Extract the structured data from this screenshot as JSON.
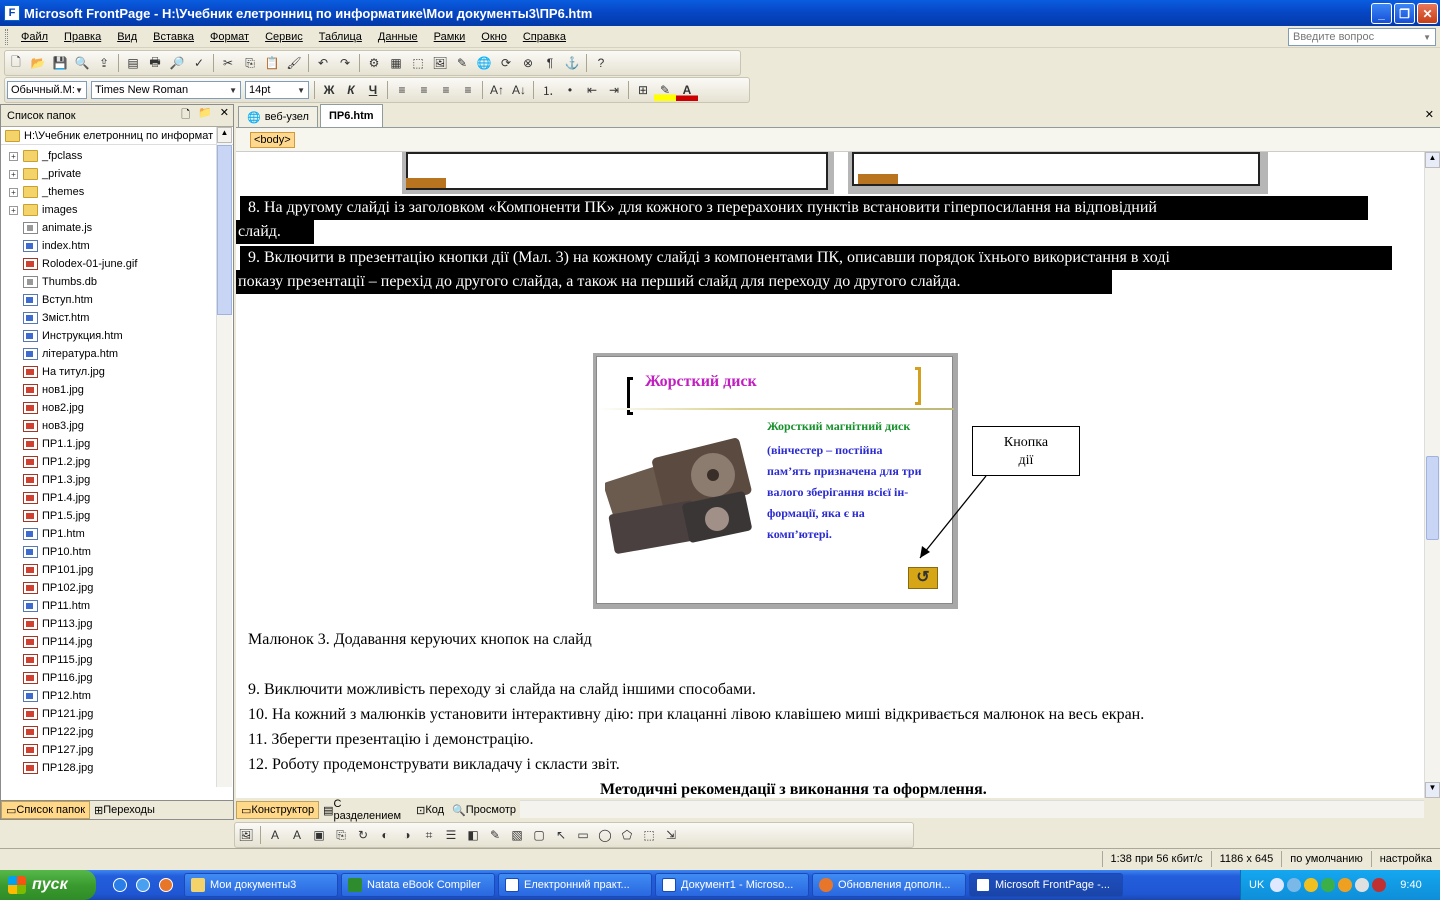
{
  "title": "Microsoft FrontPage - H:\\Учебник елетронниц по информатике\\Мои документы3\\ПР6.htm",
  "menu": [
    "Файл",
    "Правка",
    "Вид",
    "Вставка",
    "Формат",
    "Сервис",
    "Таблица",
    "Данные",
    "Рамки",
    "Окно",
    "Справка"
  ],
  "help_placeholder": "Введите вопрос",
  "format": {
    "style": "Обычный.М:",
    "font": "Times New Roman",
    "size": "14pt",
    "bold": "Ж",
    "italic": "К",
    "underline": "Ч"
  },
  "folder_panel": {
    "title": "Список папок",
    "root": "H:\\Учебник елетронниц по информат",
    "items": [
      {
        "name": "_fpclass",
        "type": "folder",
        "exp": "+"
      },
      {
        "name": "_private",
        "type": "folder",
        "exp": "+"
      },
      {
        "name": "_themes",
        "type": "folder",
        "exp": "+"
      },
      {
        "name": "images",
        "type": "folder",
        "exp": "+"
      },
      {
        "name": "animate.js",
        "type": "js"
      },
      {
        "name": "index.htm",
        "type": "htm"
      },
      {
        "name": "Rolodex-01-june.gif",
        "type": "jpg"
      },
      {
        "name": "Thumbs.db",
        "type": "js"
      },
      {
        "name": "Вступ.htm",
        "type": "htm"
      },
      {
        "name": "Зміст.htm",
        "type": "htm"
      },
      {
        "name": "Инструкция.htm",
        "type": "htm"
      },
      {
        "name": "література.htm",
        "type": "htm"
      },
      {
        "name": "На титул.jpg",
        "type": "jpg"
      },
      {
        "name": "нов1.jpg",
        "type": "jpg"
      },
      {
        "name": "нов2.jpg",
        "type": "jpg"
      },
      {
        "name": "нов3.jpg",
        "type": "jpg"
      },
      {
        "name": "ПР1.1.jpg",
        "type": "jpg"
      },
      {
        "name": "ПР1.2.jpg",
        "type": "jpg"
      },
      {
        "name": "ПР1.3.jpg",
        "type": "jpg"
      },
      {
        "name": "ПР1.4.jpg",
        "type": "jpg"
      },
      {
        "name": "ПР1.5.jpg",
        "type": "jpg"
      },
      {
        "name": "ПР1.htm",
        "type": "htm"
      },
      {
        "name": "ПР10.htm",
        "type": "htm"
      },
      {
        "name": "ПР101.jpg",
        "type": "jpg"
      },
      {
        "name": "ПР102.jpg",
        "type": "jpg"
      },
      {
        "name": "ПР11.htm",
        "type": "htm"
      },
      {
        "name": "ПР113.jpg",
        "type": "jpg"
      },
      {
        "name": "ПР114.jpg",
        "type": "jpg"
      },
      {
        "name": "ПР115.jpg",
        "type": "jpg"
      },
      {
        "name": "ПР116.jpg",
        "type": "jpg"
      },
      {
        "name": "ПР12.htm",
        "type": "htm"
      },
      {
        "name": "ПР121.jpg",
        "type": "jpg"
      },
      {
        "name": "ПР122.jpg",
        "type": "jpg"
      },
      {
        "name": "ПР127.jpg",
        "type": "jpg"
      },
      {
        "name": "ПР128.jpg",
        "type": "jpg"
      }
    ],
    "tab_folders": "Список папок",
    "tab_nav": "Переходы"
  },
  "doc_tabs": [
    "веб-узел",
    "ПР6.htm"
  ],
  "tag": "<body>",
  "doc": {
    "hl1a": "8.      На другому слайді із заголовком «Компоненти  ПК» для кожного  з перерахоних пунктів встановити  гіперпосилання на відповідний",
    "hl1b": "слайд.",
    "hl2a": "9.      Включити  в презентацію кнопки дії (Мал. 3)   на кожному слайді з компонентами ПК, описавши порядок їхнього використання в ході",
    "hl2b": "показу презентації – перехід до другого слайда, а також на перший слайд для переходу до другого слайда.",
    "slide_title": "Жорсткий диск",
    "slide_green": "Жорсткий магнітний диск",
    "slide_blue": [
      "(вінчестер – постійна",
      "пам’ять призначена для три",
      "валого зберігання всієї ін-",
      "формації, яка є на",
      "комп’ютері."
    ],
    "callout": [
      "Кнопка",
      "дії"
    ],
    "caption": "Малюнок 3.  Додавання керуючих кнопок на слайд",
    "items": [
      "9.      Виключити можливість переходу зі слайда на слайд іншими способами.",
      "10.      На  кожний  з  малюнків  установити інтерактивну дію: при клацанні  лівою клавішею миші відкривається малюнок на весь екран.",
      "11.      Зберегти презентацію і демонстрацію.",
      "12.      Роботу продемонструвати викладачу і скласти звіт."
    ],
    "heading": "Методичні рекомендації з виконання та оформлення."
  },
  "view_tabs": [
    "Конструктор",
    "С разделением",
    "Код",
    "Просмотр"
  ],
  "status": [
    "1:38 при 56 кбит/с",
    "1186 x 645",
    "по умолчанию",
    "настройка"
  ],
  "taskbar": {
    "start": "пуск",
    "tasks": [
      "Мои документы3",
      "Natata eBook Compiler",
      "Електронний практ...",
      "Документ1 - Microso...",
      "Обновления дополн...",
      "Microsoft FrontPage -..."
    ],
    "lang": "UK",
    "clock": "9:40"
  }
}
